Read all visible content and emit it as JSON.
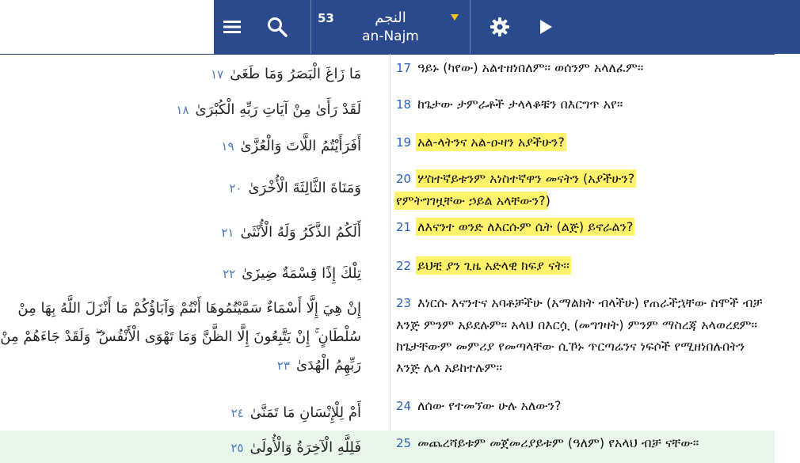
{
  "toolbar": {
    "surah_number": "53",
    "surah_name_ar": "النجم",
    "surah_name_en": "an-Najm",
    "icons": [
      "menu-icon",
      "search-icon",
      "dropdown-arrow-icon",
      "gear-icon",
      "play-icon"
    ],
    "accent": "#2b4a8e",
    "arrow_color": "#f5c518"
  },
  "highlight_color": "#fff36b",
  "active_row_color": "#e9f7ea",
  "verses": [
    {
      "num": "17",
      "ar_num": "١٧",
      "ar": "مَا زَاغَ الْبَصَرُ وَمَا طَغَىٰ",
      "tr": "ዓይኑ (ካየው) አልተዘነበለም፡፡ ወሰንም አላለፈም፡፡"
    },
    {
      "num": "18",
      "ar_num": "١٨",
      "ar": "لَقَدْ رَأَىٰ مِنْ آيَاتِ رَبِّهِ الْكُبْرَىٰ",
      "tr": "ከጌታው ታምራቶች ታላላቆቹን በእርግጥ አየ፡፡"
    },
    {
      "num": "19",
      "ar_num": "١٩",
      "ar": "أَفَرَأَيْتُمُ اللَّاتَ وَالْعُزَّىٰ",
      "tr": "አል-ላትንና አል-ዑዛን አያችሁን?"
    },
    {
      "num": "20",
      "ar_num": "٢٠",
      "ar": "وَمَنَاةَ الثَّالِثَةَ الْأُخْرَىٰ",
      "tr_a": "ሦስተኛይቱንም አነስተኛዋን መናትን (አያችሁን?",
      "tr_b": "የምትግገዟቸው ኃይል አላቸውን?",
      "tr_c": ")"
    },
    {
      "num": "21",
      "ar_num": "٢١",
      "ar": "أَلَكُمُ الذَّكَرُ وَلَهُ الْأُنْثَىٰ",
      "tr": "ለእናንተ ወንድ ለእርሱም ሴት (ልጅ) ይኖራልን?"
    },
    {
      "num": "22",
      "ar_num": "٢٢",
      "ar": "تِلْكَ إِذًا قِسْمَةٌ ضِيزَىٰ",
      "tr": "ይህቺ ያን ጊዜ አድላዊ ክፍያ ናት፡፡"
    },
    {
      "num": "23",
      "ar_num": "٢٣",
      "ar": "إِنْ هِيَ إِلَّا أَسْمَاءٌ سَمَّيْتُمُوهَا أَنْتُمْ وَآبَاؤُكُمْ مَا أَنْزَلَ اللَّهُ بِهَا مِنْ سُلْطَانٍ ۚ إِنْ يَتَّبِعُونَ إِلَّا الظَّنَّ وَمَا تَهْوَى الْأَنْفُسُ ۖ وَلَقَدْ جَاءَهُمْ مِنْ رَبِّهِمُ الْهُدَىٰ",
      "tr": "እነርሱ እናንተና አባቶቻችሁ (አማልክት ብላችሁ) የጠራችኋቸው ስሞች ብቻ እንጅ ምንም አይደሉም፡፡ አላህ በእርሷ (መግገዛት) ምንም ማስረጃ አላወረደም፡፡ ከጌታቸውም መምሪያ የመጣላቸው ሲኾኑ ጥርጣሬንና ነፍሶች የሚዘነበሉበትን እንጅ ሌላ አይከተሉም፡፡"
    },
    {
      "num": "24",
      "ar_num": "٢٤",
      "ar": "أَمْ لِلْإِنْسَانِ مَا تَمَنَّىٰ",
      "tr": "ለሰው የተመኘው ሁሉ አለውን?"
    },
    {
      "num": "25",
      "ar_num": "٢٥",
      "ar": "فَلِلَّهِ الْآخِرَةُ وَالْأُولَىٰ",
      "tr": "መጨረሻይቱም መጀመሪያይቱም (ዓለም) የአላህ ብቻ ናቸው፡፡"
    }
  ]
}
